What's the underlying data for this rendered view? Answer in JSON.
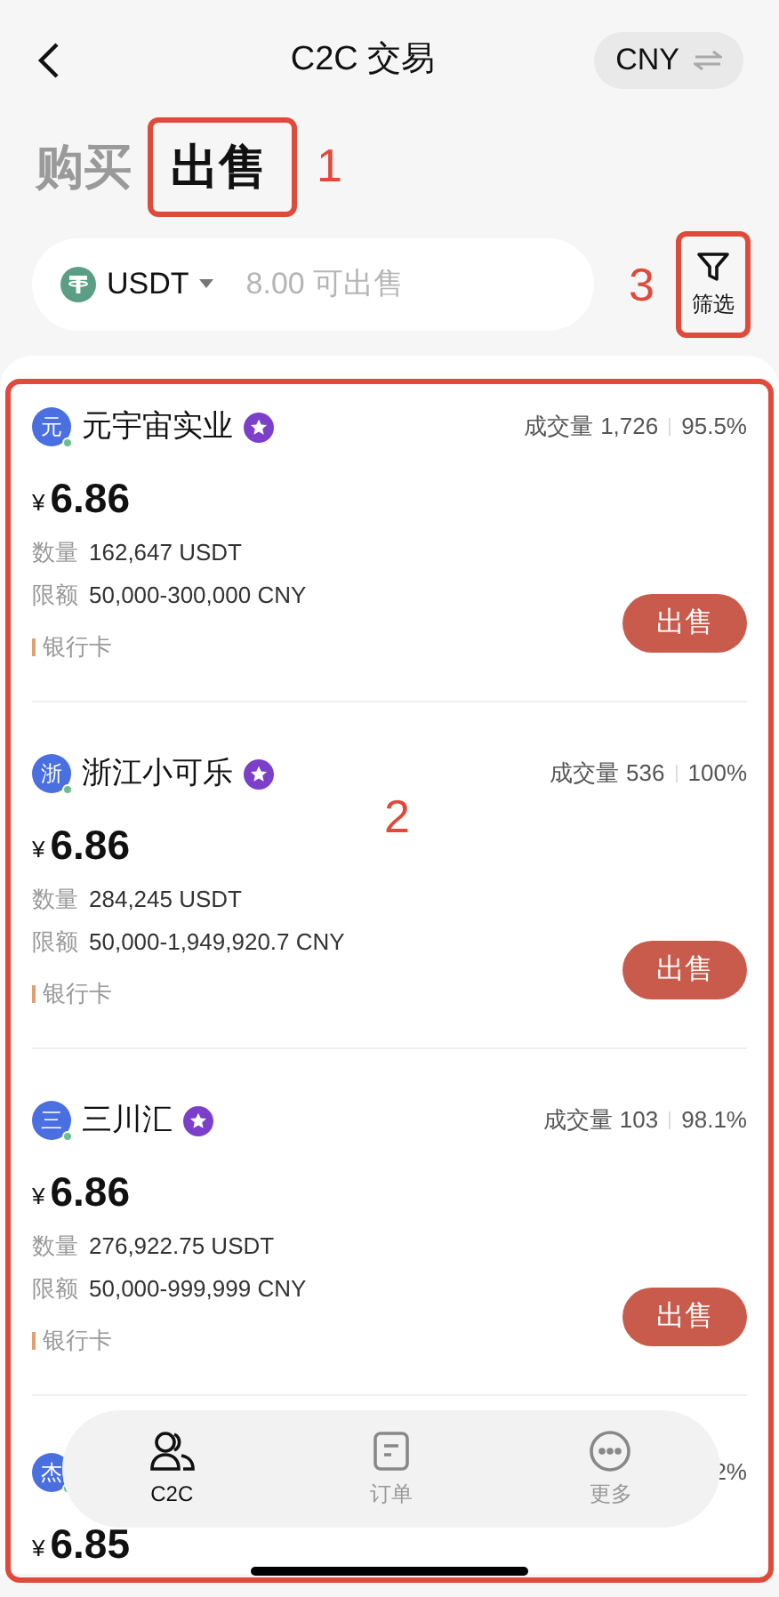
{
  "header": {
    "title": "C2C 交易",
    "currency": "CNY"
  },
  "tabs": [
    {
      "label": "购买",
      "selected": false
    },
    {
      "label": "出售",
      "selected": true
    }
  ],
  "asset": {
    "coin": "USDT",
    "available": "8.00 可出售"
  },
  "filter": {
    "label": "筛选"
  },
  "listings": [
    {
      "avatar": "元",
      "name": "元宇宙实业",
      "volume_label": "成交量",
      "volume": "1,726",
      "rate": "95.5%",
      "currency_symbol": "¥",
      "price": "6.86",
      "amount_label": "数量",
      "amount": "162,647 USDT",
      "limit_label": "限额",
      "limit": "50,000-300,000 CNY",
      "payment": "银行卡",
      "action": "出售"
    },
    {
      "avatar": "浙",
      "name": "浙江小可乐",
      "volume_label": "成交量",
      "volume": "536",
      "rate": "100%",
      "currency_symbol": "¥",
      "price": "6.86",
      "amount_label": "数量",
      "amount": "284,245 USDT",
      "limit_label": "限额",
      "limit": "50,000-1,949,920.7 CNY",
      "payment": "银行卡",
      "action": "出售"
    },
    {
      "avatar": "三",
      "name": "三川汇",
      "volume_label": "成交量",
      "volume": "103",
      "rate": "98.1%",
      "currency_symbol": "¥",
      "price": "6.86",
      "amount_label": "数量",
      "amount": "276,922.75 USDT",
      "limit_label": "限额",
      "limit": "50,000-999,999 CNY",
      "payment": "银行卡",
      "action": "出售"
    }
  ],
  "partial_listing": {
    "avatar": "杰",
    "rate": "2%",
    "currency_symbol": "¥",
    "price": "6.85"
  },
  "bottom_nav": [
    {
      "label": "C2C",
      "kind": "people",
      "selected": true
    },
    {
      "label": "订单",
      "kind": "orders",
      "selected": false
    },
    {
      "label": "更多",
      "kind": "more",
      "selected": false
    }
  ],
  "annotations": {
    "tabs": "1",
    "list": "2",
    "filter": "3"
  }
}
